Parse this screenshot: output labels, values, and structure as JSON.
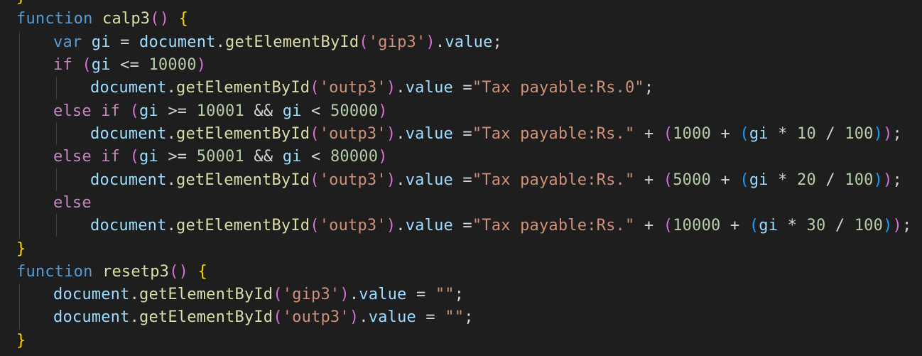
{
  "editor": {
    "theme_colors": {
      "background": "#1e1e1e",
      "keyword": "#569cd6",
      "control": "#c586c0",
      "function": "#dcdcaa",
      "variable": "#9cdcfe",
      "string": "#ce9178",
      "number": "#b5cea8",
      "bracket_level1": "#ffd700",
      "bracket_level2": "#da70d6",
      "bracket_level3": "#179fff"
    },
    "lines": [
      {
        "tokens": [
          {
            "text": "}",
            "cls": "b1"
          }
        ]
      },
      {
        "tokens": [
          {
            "text": "function",
            "cls": "kw"
          },
          {
            "text": " ",
            "cls": "op"
          },
          {
            "text": "calp3",
            "cls": "fn"
          },
          {
            "text": "()",
            "cls": "b2"
          },
          {
            "text": " ",
            "cls": "op"
          },
          {
            "text": "{",
            "cls": "b1"
          }
        ]
      },
      {
        "tokens": [
          {
            "text": "var",
            "cls": "kw"
          },
          {
            "text": " ",
            "cls": "op"
          },
          {
            "text": "gi",
            "cls": "var"
          },
          {
            "text": " = ",
            "cls": "op"
          },
          {
            "text": "document",
            "cls": "var"
          },
          {
            "text": ".",
            "cls": "op"
          },
          {
            "text": "getElementById",
            "cls": "fn"
          },
          {
            "text": "(",
            "cls": "b2"
          },
          {
            "text": "'gip3'",
            "cls": "str"
          },
          {
            "text": ")",
            "cls": "b2"
          },
          {
            "text": ".",
            "cls": "op"
          },
          {
            "text": "value",
            "cls": "var"
          },
          {
            "text": ";",
            "cls": "op"
          }
        ]
      },
      {
        "tokens": [
          {
            "text": "if",
            "cls": "ctl"
          },
          {
            "text": " ",
            "cls": "op"
          },
          {
            "text": "(",
            "cls": "b2"
          },
          {
            "text": "gi",
            "cls": "var"
          },
          {
            "text": " <= ",
            "cls": "op"
          },
          {
            "text": "10000",
            "cls": "num"
          },
          {
            "text": ")",
            "cls": "b2"
          }
        ]
      },
      {
        "tokens": [
          {
            "text": "document",
            "cls": "var"
          },
          {
            "text": ".",
            "cls": "op"
          },
          {
            "text": "getElementById",
            "cls": "fn"
          },
          {
            "text": "(",
            "cls": "b2"
          },
          {
            "text": "'outp3'",
            "cls": "str"
          },
          {
            "text": ")",
            "cls": "b2"
          },
          {
            "text": ".",
            "cls": "op"
          },
          {
            "text": "value",
            "cls": "var"
          },
          {
            "text": " =",
            "cls": "op"
          },
          {
            "text": "\"Tax payable:Rs.0\"",
            "cls": "str"
          },
          {
            "text": ";",
            "cls": "op"
          }
        ]
      },
      {
        "tokens": [
          {
            "text": "else",
            "cls": "ctl"
          },
          {
            "text": " ",
            "cls": "op"
          },
          {
            "text": "if",
            "cls": "ctl"
          },
          {
            "text": " ",
            "cls": "op"
          },
          {
            "text": "(",
            "cls": "b2"
          },
          {
            "text": "gi",
            "cls": "var"
          },
          {
            "text": " >= ",
            "cls": "op"
          },
          {
            "text": "10001",
            "cls": "num"
          },
          {
            "text": " && ",
            "cls": "op"
          },
          {
            "text": "gi",
            "cls": "var"
          },
          {
            "text": " < ",
            "cls": "op"
          },
          {
            "text": "50000",
            "cls": "num"
          },
          {
            "text": ")",
            "cls": "b2"
          }
        ]
      },
      {
        "tokens": [
          {
            "text": "document",
            "cls": "var"
          },
          {
            "text": ".",
            "cls": "op"
          },
          {
            "text": "getElementById",
            "cls": "fn"
          },
          {
            "text": "(",
            "cls": "b2"
          },
          {
            "text": "'outp3'",
            "cls": "str"
          },
          {
            "text": ")",
            "cls": "b2"
          },
          {
            "text": ".",
            "cls": "op"
          },
          {
            "text": "value",
            "cls": "var"
          },
          {
            "text": " =",
            "cls": "op"
          },
          {
            "text": "\"Tax payable:Rs.\"",
            "cls": "str"
          },
          {
            "text": " + ",
            "cls": "op"
          },
          {
            "text": "(",
            "cls": "b2"
          },
          {
            "text": "1000",
            "cls": "num"
          },
          {
            "text": " + ",
            "cls": "op"
          },
          {
            "text": "(",
            "cls": "b3"
          },
          {
            "text": "gi",
            "cls": "var"
          },
          {
            "text": " * ",
            "cls": "op"
          },
          {
            "text": "10",
            "cls": "num"
          },
          {
            "text": " / ",
            "cls": "op"
          },
          {
            "text": "100",
            "cls": "num"
          },
          {
            "text": ")",
            "cls": "b3"
          },
          {
            "text": ")",
            "cls": "b2"
          },
          {
            "text": ";",
            "cls": "op"
          }
        ]
      },
      {
        "tokens": [
          {
            "text": "else",
            "cls": "ctl"
          },
          {
            "text": " ",
            "cls": "op"
          },
          {
            "text": "if",
            "cls": "ctl"
          },
          {
            "text": " ",
            "cls": "op"
          },
          {
            "text": "(",
            "cls": "b2"
          },
          {
            "text": "gi",
            "cls": "var"
          },
          {
            "text": " >= ",
            "cls": "op"
          },
          {
            "text": "50001",
            "cls": "num"
          },
          {
            "text": " && ",
            "cls": "op"
          },
          {
            "text": "gi",
            "cls": "var"
          },
          {
            "text": " < ",
            "cls": "op"
          },
          {
            "text": "80000",
            "cls": "num"
          },
          {
            "text": ")",
            "cls": "b2"
          }
        ]
      },
      {
        "tokens": [
          {
            "text": "document",
            "cls": "var"
          },
          {
            "text": ".",
            "cls": "op"
          },
          {
            "text": "getElementById",
            "cls": "fn"
          },
          {
            "text": "(",
            "cls": "b2"
          },
          {
            "text": "'outp3'",
            "cls": "str"
          },
          {
            "text": ")",
            "cls": "b2"
          },
          {
            "text": ".",
            "cls": "op"
          },
          {
            "text": "value",
            "cls": "var"
          },
          {
            "text": " =",
            "cls": "op"
          },
          {
            "text": "\"Tax payable:Rs.\"",
            "cls": "str"
          },
          {
            "text": " + ",
            "cls": "op"
          },
          {
            "text": "(",
            "cls": "b2"
          },
          {
            "text": "5000",
            "cls": "num"
          },
          {
            "text": " + ",
            "cls": "op"
          },
          {
            "text": "(",
            "cls": "b3"
          },
          {
            "text": "gi",
            "cls": "var"
          },
          {
            "text": " * ",
            "cls": "op"
          },
          {
            "text": "20",
            "cls": "num"
          },
          {
            "text": " / ",
            "cls": "op"
          },
          {
            "text": "100",
            "cls": "num"
          },
          {
            "text": ")",
            "cls": "b3"
          },
          {
            "text": ")",
            "cls": "b2"
          },
          {
            "text": ";",
            "cls": "op"
          }
        ]
      },
      {
        "tokens": [
          {
            "text": "else",
            "cls": "ctl"
          }
        ]
      },
      {
        "tokens": [
          {
            "text": "document",
            "cls": "var"
          },
          {
            "text": ".",
            "cls": "op"
          },
          {
            "text": "getElementById",
            "cls": "fn"
          },
          {
            "text": "(",
            "cls": "b2"
          },
          {
            "text": "'outp3'",
            "cls": "str"
          },
          {
            "text": ")",
            "cls": "b2"
          },
          {
            "text": ".",
            "cls": "op"
          },
          {
            "text": "value",
            "cls": "var"
          },
          {
            "text": " =",
            "cls": "op"
          },
          {
            "text": "\"Tax payable:Rs.\"",
            "cls": "str"
          },
          {
            "text": " + ",
            "cls": "op"
          },
          {
            "text": "(",
            "cls": "b2"
          },
          {
            "text": "10000",
            "cls": "num"
          },
          {
            "text": " + ",
            "cls": "op"
          },
          {
            "text": "(",
            "cls": "b3"
          },
          {
            "text": "gi",
            "cls": "var"
          },
          {
            "text": " * ",
            "cls": "op"
          },
          {
            "text": "30",
            "cls": "num"
          },
          {
            "text": " / ",
            "cls": "op"
          },
          {
            "text": "100",
            "cls": "num"
          },
          {
            "text": ")",
            "cls": "b3"
          },
          {
            "text": ")",
            "cls": "b2"
          },
          {
            "text": ";",
            "cls": "op"
          }
        ]
      },
      {
        "tokens": [
          {
            "text": "}",
            "cls": "b1"
          }
        ]
      },
      {
        "tokens": [
          {
            "text": "function",
            "cls": "kw"
          },
          {
            "text": " ",
            "cls": "op"
          },
          {
            "text": "resetp3",
            "cls": "fn"
          },
          {
            "text": "()",
            "cls": "b2"
          },
          {
            "text": " ",
            "cls": "op"
          },
          {
            "text": "{",
            "cls": "b1"
          }
        ]
      },
      {
        "tokens": [
          {
            "text": "document",
            "cls": "var"
          },
          {
            "text": ".",
            "cls": "op"
          },
          {
            "text": "getElementById",
            "cls": "fn"
          },
          {
            "text": "(",
            "cls": "b2"
          },
          {
            "text": "'gip3'",
            "cls": "str"
          },
          {
            "text": ")",
            "cls": "b2"
          },
          {
            "text": ".",
            "cls": "op"
          },
          {
            "text": "value",
            "cls": "var"
          },
          {
            "text": " = ",
            "cls": "op"
          },
          {
            "text": "\"\"",
            "cls": "str"
          },
          {
            "text": ";",
            "cls": "op"
          }
        ]
      },
      {
        "tokens": [
          {
            "text": "document",
            "cls": "var"
          },
          {
            "text": ".",
            "cls": "op"
          },
          {
            "text": "getElementById",
            "cls": "fn"
          },
          {
            "text": "(",
            "cls": "b2"
          },
          {
            "text": "'outp3'",
            "cls": "str"
          },
          {
            "text": ")",
            "cls": "b2"
          },
          {
            "text": ".",
            "cls": "op"
          },
          {
            "text": "value",
            "cls": "var"
          },
          {
            "text": " = ",
            "cls": "op"
          },
          {
            "text": "\"\"",
            "cls": "str"
          },
          {
            "text": ";",
            "cls": "op"
          }
        ]
      },
      {
        "tokens": [
          {
            "text": "}",
            "cls": "b1"
          }
        ]
      }
    ]
  }
}
